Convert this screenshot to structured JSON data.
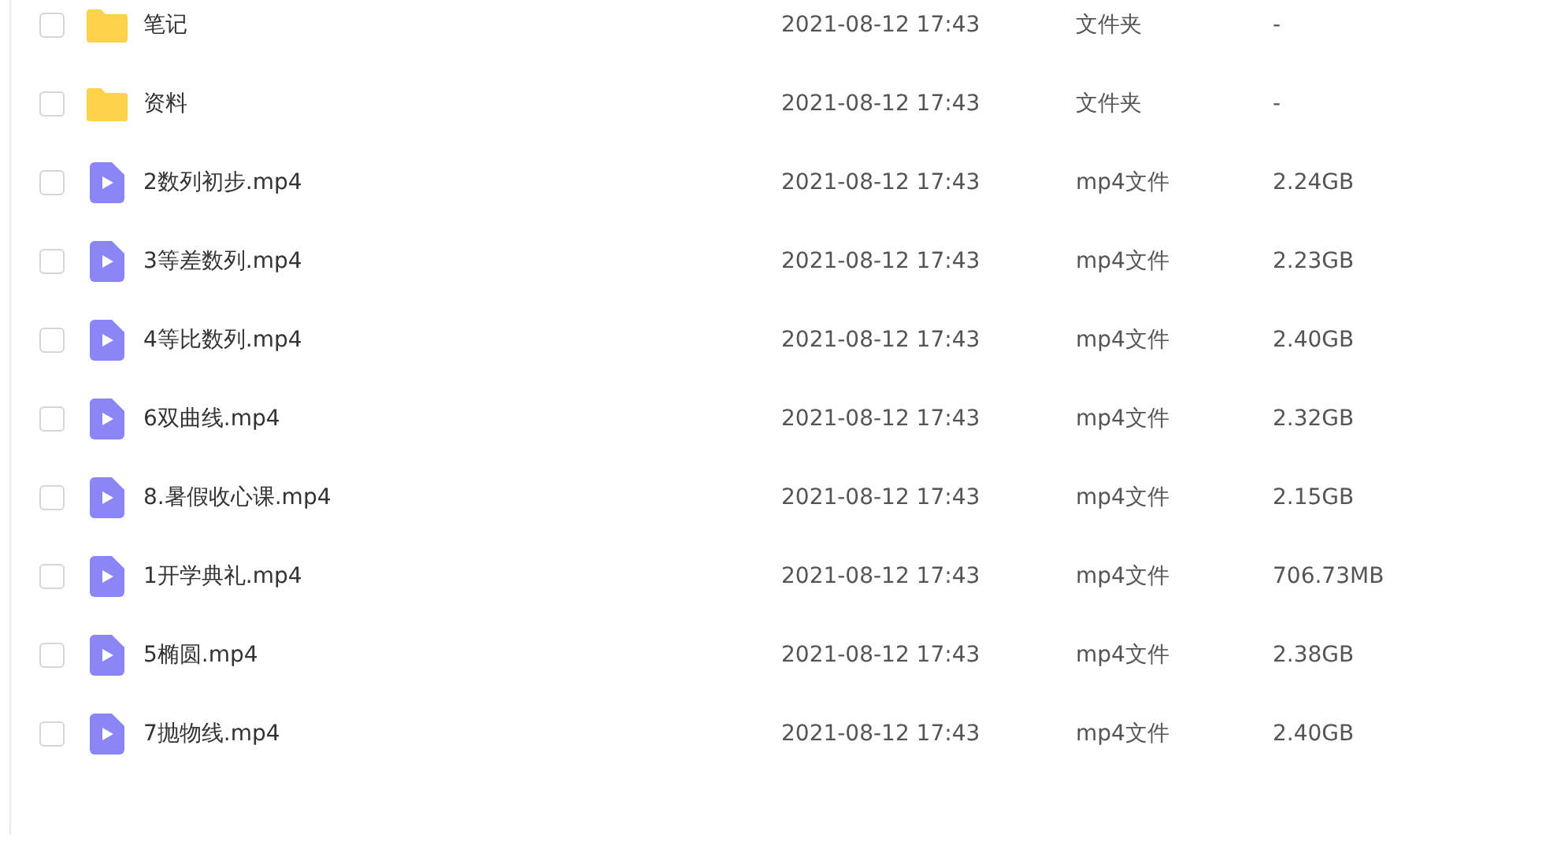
{
  "files": [
    {
      "kind": "folder",
      "name": "笔记",
      "modified": "2021-08-12 17:43",
      "type": "文件夹",
      "size": "-",
      "checked": false
    },
    {
      "kind": "folder",
      "name": "资料",
      "modified": "2021-08-12 17:43",
      "type": "文件夹",
      "size": "-",
      "checked": false
    },
    {
      "kind": "video",
      "name": "2数列初步.mp4",
      "modified": "2021-08-12 17:43",
      "type": "mp4文件",
      "size": "2.24GB",
      "checked": false
    },
    {
      "kind": "video",
      "name": "3等差数列.mp4",
      "modified": "2021-08-12 17:43",
      "type": "mp4文件",
      "size": "2.23GB",
      "checked": false
    },
    {
      "kind": "video",
      "name": "4等比数列.mp4",
      "modified": "2021-08-12 17:43",
      "type": "mp4文件",
      "size": "2.40GB",
      "checked": false
    },
    {
      "kind": "video",
      "name": "6双曲线.mp4",
      "modified": "2021-08-12 17:43",
      "type": "mp4文件",
      "size": "2.32GB",
      "checked": false
    },
    {
      "kind": "video",
      "name": "8.暑假收心课.mp4",
      "modified": "2021-08-12 17:43",
      "type": "mp4文件",
      "size": "2.15GB",
      "checked": false
    },
    {
      "kind": "video",
      "name": "1开学典礼.mp4",
      "modified": "2021-08-12 17:43",
      "type": "mp4文件",
      "size": "706.73MB",
      "checked": false
    },
    {
      "kind": "video",
      "name": "5椭圆.mp4",
      "modified": "2021-08-12 17:43",
      "type": "mp4文件",
      "size": "2.38GB",
      "checked": false
    },
    {
      "kind": "video",
      "name": "7抛物线.mp4",
      "modified": "2021-08-12 17:43",
      "type": "mp4文件",
      "size": "2.40GB",
      "checked": false
    }
  ]
}
